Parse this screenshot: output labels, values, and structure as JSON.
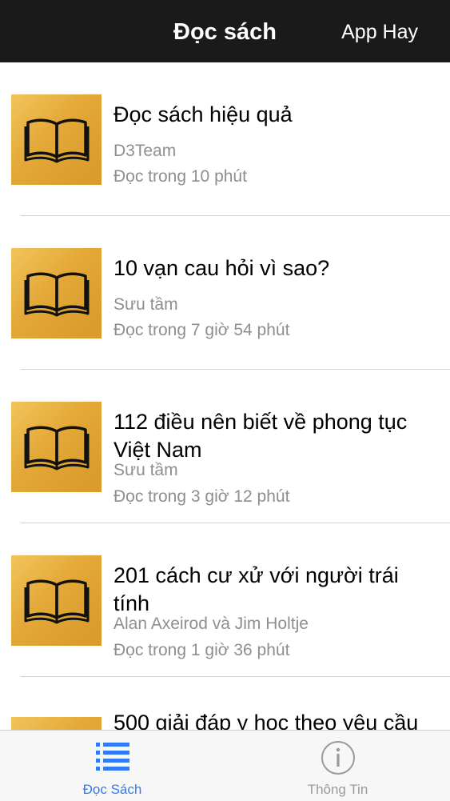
{
  "header": {
    "title": "Đọc sách",
    "right_label": "App Hay"
  },
  "books": [
    {
      "title": "Đọc sách hiệu quả",
      "author": "D3Team",
      "read_time": "Đọc trong 10 phút"
    },
    {
      "title": "10 vạn cau hỏi vì sao?",
      "author": "Sưu tầm",
      "read_time": "Đọc trong 7 giờ 54 phút"
    },
    {
      "title": "112 điều nên biết về phong tục Việt Nam",
      "author": "Sưu tầm",
      "read_time": "Đọc trong 3 giờ 12 phút"
    },
    {
      "title": "201 cách cư xử với người trái tính",
      "author": "Alan Axeirod và Jim Holtje",
      "read_time": "Đọc trong 1 giờ 36 phút"
    },
    {
      "title": "500 giải đáp y học theo yêu cầu"
    }
  ],
  "tabs": [
    {
      "label": "Đọc Sách",
      "icon": "list-icon",
      "active": true
    },
    {
      "label": "Thông Tin",
      "icon": "info-icon",
      "active": false
    }
  ],
  "colors": {
    "accent": "#2f7cf6",
    "inactive": "#9a9a9a",
    "header_bg": "#1a1a1a",
    "thumb_gold": "#e3a836"
  }
}
